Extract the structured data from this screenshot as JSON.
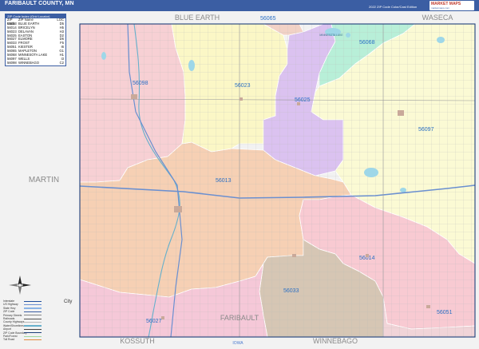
{
  "header": {
    "title": "FARIBAULT COUNTY, MN",
    "edition": "2022 ZIP Code Color/Cast Edition",
    "logo_mark": "MARKET MAPS",
    "logo_sub": "marketmaps.com"
  },
  "legend": {
    "header": "ZIP Code Index (Grid Locator)",
    "columns": {
      "code": "ZIP Code",
      "name": "ZIP Name",
      "loc": "LOC"
    },
    "rows": [
      {
        "code": "56013",
        "name": "BLUE EARTH",
        "loc": "D5"
      },
      {
        "code": "56014",
        "name": "BRICELYN",
        "loc": "H5"
      },
      {
        "code": "56023",
        "name": "DELAVAN",
        "loc": "H3"
      },
      {
        "code": "56025",
        "name": "EASTON",
        "loc": "D2"
      },
      {
        "code": "56027",
        "name": "ELMORE",
        "loc": "D6"
      },
      {
        "code": "56033",
        "name": "FROST",
        "loc": "F5"
      },
      {
        "code": "56051",
        "name": "KIESTER",
        "loc": "I6"
      },
      {
        "code": "56065",
        "name": "MAPLETON",
        "loc": "G1"
      },
      {
        "code": "56068",
        "name": "MINNESOTA LAKE",
        "loc": "H1"
      },
      {
        "code": "56097",
        "name": "WELLS",
        "loc": "I3"
      },
      {
        "code": "56098",
        "name": "WINNEBAGO",
        "loc": "C2"
      }
    ]
  },
  "map": {
    "colors": {
      "z56013": "#f6d0b4",
      "z56014": "#f8cad2",
      "z56023": "#fbf7c6",
      "z56025": "#dbc2f0",
      "z56027": "#f5c8d8",
      "z56033": "#d6c6b4",
      "z56051": "#f1d4d8",
      "z56065": "#f2d2c6",
      "z56068": "#b8efd8",
      "z56097": "#fbfad4",
      "z56098": "#f7d0d4",
      "outside": "#f2f2f2",
      "water": "#9ed7e8",
      "highway": "#6a8fd0",
      "road": "#9a9a9a",
      "river": "#66b0cc",
      "zip_label": "#2a6fc4",
      "county_label": "#8a8a8a",
      "boundary": "#1e3f7a"
    },
    "neighbor_counties": {
      "north_a": "BLUE EARTH",
      "north_b": "WASECA",
      "west": "MARTIN",
      "south_a": "KOSSUTH",
      "south_b": "WINNEBAGO",
      "south_state": "IOWA",
      "south_center": "FARIBAULT"
    },
    "zip_labels": {
      "z56065": "56065",
      "z56068": "56068",
      "z56098": "56098",
      "z56023": "56023",
      "z56025": "56025",
      "z56097": "56097",
      "z56013": "56013",
      "z56014": "56014",
      "z56033": "56033",
      "z56027": "56027",
      "z56051": "56051"
    },
    "lake_label": "MINNESOTA LAKE"
  },
  "map_key": {
    "items": [
      {
        "label": "Interstate",
        "color": "#1f4e9c"
      },
      {
        "label": "US Highway",
        "color": "#6a8fd0"
      },
      {
        "label": "State Hwy",
        "color": "#8ab4e6"
      },
      {
        "label": "ZIP Code",
        "color": "#3b5ea3"
      },
      {
        "label": "Primary Streets",
        "color": "#888888"
      },
      {
        "label": "Railroads",
        "color": "#555555"
      },
      {
        "label": "County Highways",
        "color": "#bbbbbb"
      },
      {
        "label": "Water/Shorelines",
        "color": "#66b0cc"
      },
      {
        "label": "Airport",
        "color": "#444444"
      },
      {
        "label": "ZIP Code Boundary",
        "color": "#1e3f7a"
      },
      {
        "label": "Park/Forest",
        "color": "#9ed79e"
      },
      {
        "label": "Toll Road",
        "color": "#e08a3c"
      }
    ],
    "city_label": "City"
  }
}
